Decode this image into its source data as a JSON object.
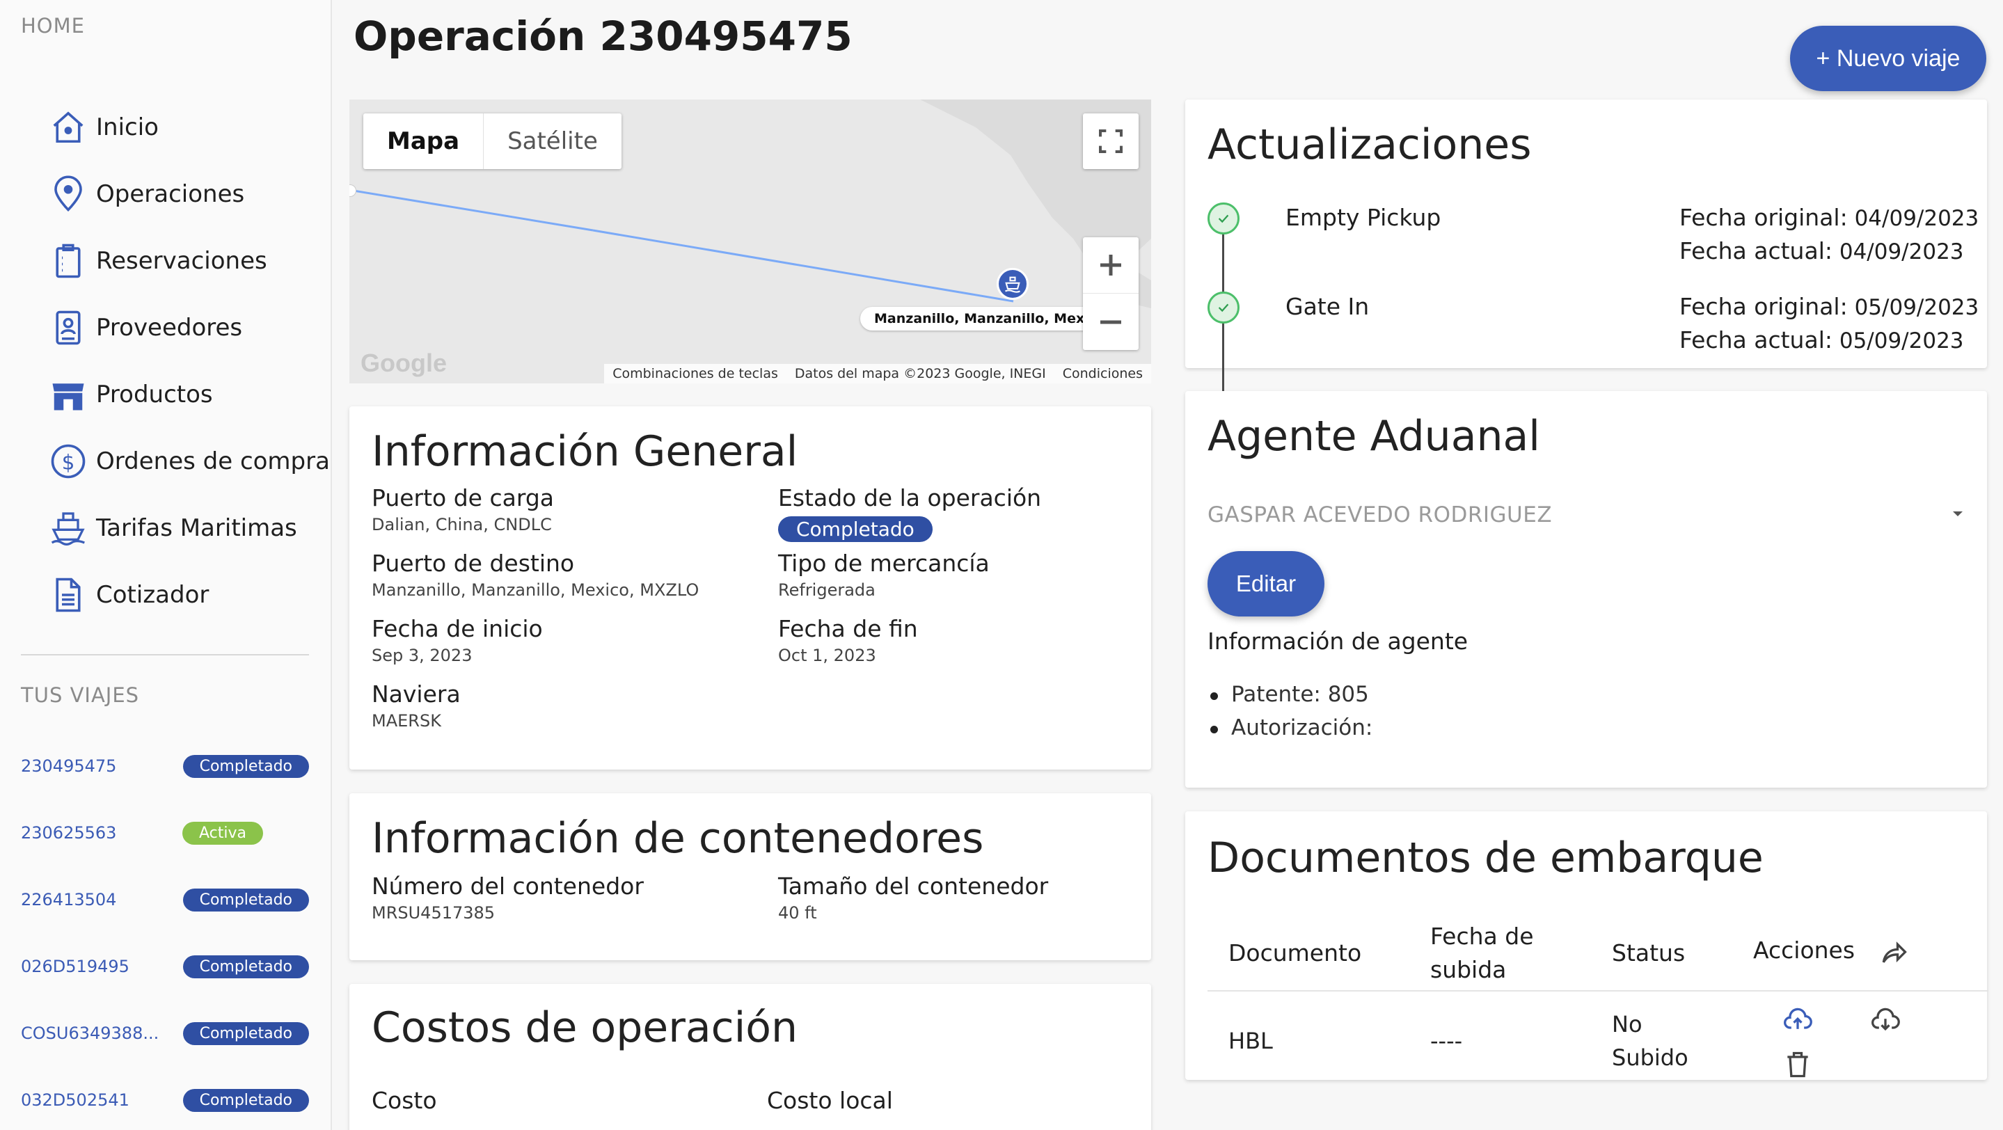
{
  "sidebar": {
    "home_heading": "HOME",
    "nav": [
      {
        "label": "Inicio",
        "icon": "home-icon"
      },
      {
        "label": "Operaciones",
        "icon": "location-pin-icon"
      },
      {
        "label": "Reservaciones",
        "icon": "clipboard-icon"
      },
      {
        "label": "Proveedores",
        "icon": "contact-card-icon"
      },
      {
        "label": "Productos",
        "icon": "store-icon"
      },
      {
        "label": "Ordenes de compra",
        "icon": "dollar-circle-icon"
      },
      {
        "label": "Tarifas Maritimas",
        "icon": "ship-icon"
      },
      {
        "label": "Cotizador",
        "icon": "document-icon"
      }
    ],
    "trips_heading": "TUS VIAJES",
    "trips": [
      {
        "id": "230495475",
        "status": "Completado"
      },
      {
        "id": "230625563",
        "status": "Activa"
      },
      {
        "id": "226413504",
        "status": "Completado"
      },
      {
        "id": "026D519495",
        "status": "Completado"
      },
      {
        "id": "COSU6349388...",
        "status": "Completado"
      },
      {
        "id": "032D502541",
        "status": "Completado"
      }
    ]
  },
  "header": {
    "title": "Operación 230495475",
    "new_trip_label": "+ Nuevo viaje"
  },
  "map": {
    "tab_map": "Mapa",
    "tab_satellite": "Satélite",
    "marker_label": "Manzanillo, Manzanillo, Mexico",
    "logo": "Google",
    "footer": [
      "Combinaciones de teclas",
      "Datos del mapa ©2023 Google, INEGI",
      "Condiciones"
    ],
    "route_color": "#7baaf7"
  },
  "general": {
    "title": "Información General",
    "fields": [
      {
        "label": "Puerto de carga",
        "value": "Dalian, China, CNDLC"
      },
      {
        "label": "Estado de la operación",
        "value": "Completado"
      },
      {
        "label": "Puerto de destino",
        "value": "Manzanillo, Manzanillo, Mexico, MXZLO"
      },
      {
        "label": "Tipo de mercancía",
        "value": "Refrigerada"
      },
      {
        "label": "Fecha de inicio",
        "value": "Sep 3, 2023"
      },
      {
        "label": "Fecha de fin",
        "value": "Oct 1, 2023"
      },
      {
        "label": "Naviera",
        "value": "MAERSK"
      }
    ]
  },
  "containers": {
    "title": "Información de contenedores",
    "fields": [
      {
        "label": "Número del contenedor",
        "value": "MRSU4517385"
      },
      {
        "label": "Tamaño del contenedor",
        "value": "40 ft"
      }
    ]
  },
  "costs": {
    "title": "Costos de operación",
    "col1": "Costo",
    "col2": "Costo local"
  },
  "updates": {
    "title": "Actualizaciones",
    "original_label": "Fecha original:",
    "current_label": "Fecha actual:",
    "items": [
      {
        "name": "Empty Pickup",
        "original": "04/09/2023",
        "current": "04/09/2023"
      },
      {
        "name": "Gate In",
        "original": "05/09/2023",
        "current": "05/09/2023"
      }
    ]
  },
  "agent": {
    "title": "Agente Aduanal",
    "selected": "GASPAR ACEVEDO RODRIGUEZ",
    "edit_label": "Editar",
    "info_heading": "Información de agente",
    "items": [
      "Patente: 805",
      "Autorización:"
    ]
  },
  "docs": {
    "title": "Documentos de embarque",
    "headers": [
      "Documento",
      "Fecha de subida",
      "Status",
      "Acciones"
    ],
    "rows": [
      {
        "document": "HBL",
        "date": "----",
        "status": "No Subido"
      }
    ]
  },
  "colors": {
    "primary": "#3a5db8",
    "badge_done": "#2f4fa3",
    "badge_active": "#8bc34a",
    "success": "#4cbf6a"
  }
}
